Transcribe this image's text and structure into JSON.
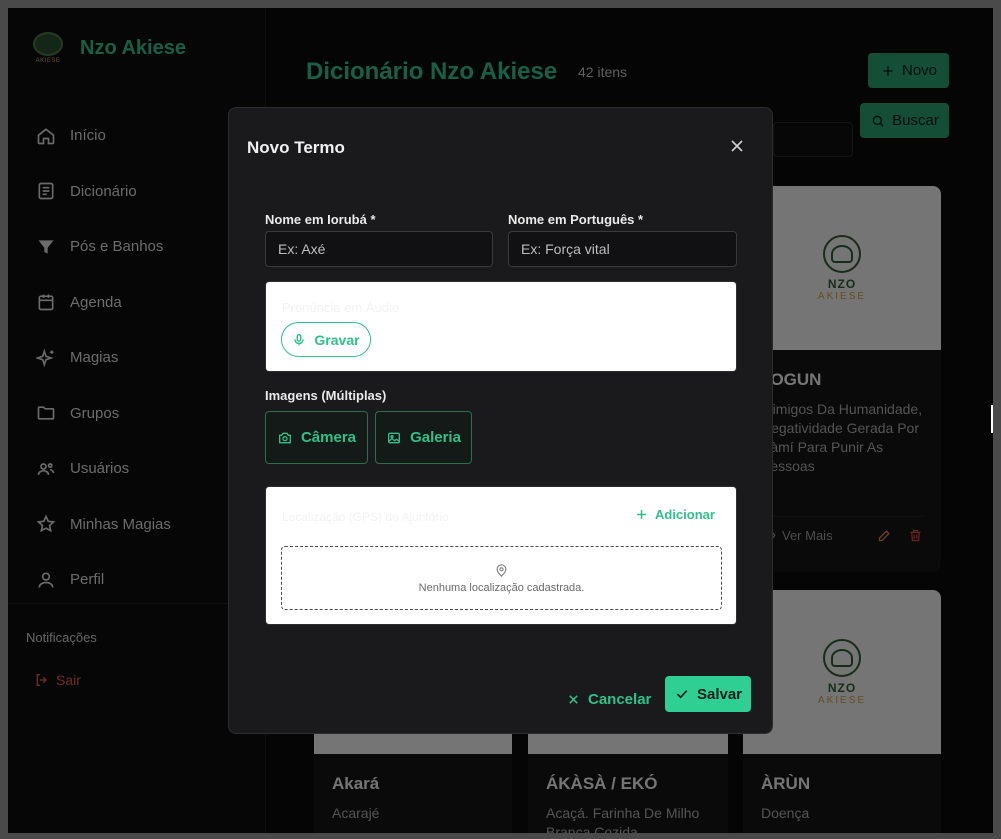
{
  "brand": {
    "name": "Nzo Akiese",
    "logo_small_text": "AKIESE"
  },
  "sidebar": {
    "items": [
      {
        "label": "Início",
        "icon": "home-icon"
      },
      {
        "label": "Dicionário",
        "icon": "book-icon"
      },
      {
        "label": "Pós e Banhos",
        "icon": "funnel-icon"
      },
      {
        "label": "Agenda",
        "icon": "calendar-icon"
      },
      {
        "label": "Magias",
        "icon": "sparkles-icon"
      },
      {
        "label": "Grupos",
        "icon": "folder-icon"
      },
      {
        "label": "Usuários",
        "icon": "users-icon"
      },
      {
        "label": "Minhas Magias",
        "icon": "star-icon"
      },
      {
        "label": "Perfil",
        "icon": "user-icon"
      }
    ],
    "notifications_label": "Notificações",
    "logout_label": "Sair"
  },
  "main": {
    "title": "Dicionário Nzo Akiese",
    "count": "42 itens",
    "new_button": "Novo",
    "search_button": "Buscar",
    "cards": [
      {
        "title": "JOGUN",
        "desc": "Inimigos Da Humanidade, Negatividade Gerada Por Ṣàmí Para Punir As Pessoas",
        "view_more": "Ver Mais",
        "logo_text": "NZO",
        "logo_sub": "AKIESE"
      },
      {
        "title": "Akará",
        "desc": "Acarajé"
      },
      {
        "title": "ÁKÀSÀ / EKÓ",
        "desc": "Acaçá. Farinha De Milho Branca Cozida"
      },
      {
        "title": "ÀRÙN",
        "desc": "Doença",
        "logo_text": "NZO",
        "logo_sub": "AKIESE"
      }
    ]
  },
  "modal": {
    "title": "Novo Termo",
    "yoruba_label": "Nome em Iorubá *",
    "yoruba_placeholder": "Ex: Axé",
    "portuguese_label": "Nome em Português *",
    "portuguese_placeholder": "Ex: Força vital",
    "audio_label": "Pronúncia em Áudio",
    "record_button": "Gravar",
    "images_label": "Imagens (Múltiplas)",
    "camera_button": "Câmera",
    "gallery_button": "Galeria",
    "location_label": "Localização (GPS) do Ajuntório",
    "add_button": "Adicionar",
    "empty_location": "Nenhuma localização cadastrada.",
    "cancel_button": "Cancelar",
    "save_button": "Salvar"
  }
}
